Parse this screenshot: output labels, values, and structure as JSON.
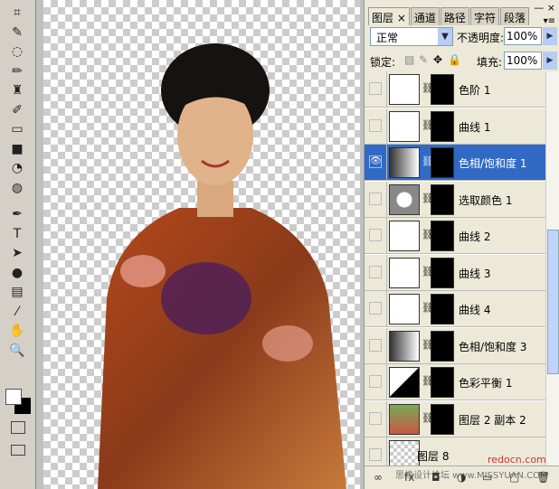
{
  "tools": [
    "crop-icon",
    "slice-icon",
    "lasso-icon",
    "brush-icon",
    "stamp-icon",
    "history-brush-icon",
    "eraser-icon",
    "gradient-icon",
    "blur-icon",
    "dodge-icon",
    "pen-icon",
    "type-icon",
    "path-select-icon",
    "shape-icon",
    "notes-icon",
    "eyedropper-icon",
    "hand-icon",
    "zoom-icon"
  ],
  "tool_glyphs": [
    "⌗",
    "✎",
    "◌",
    "✏",
    "♜",
    "✐",
    "▭",
    "■",
    "◔",
    "◍",
    "✒",
    "T",
    "➤",
    "●",
    "▤",
    "⁄",
    "✋",
    "🔍"
  ],
  "panel": {
    "tabs": [
      "图层",
      "通道",
      "路径",
      "字符",
      "段落"
    ],
    "close_tab": "×",
    "blend_mode": "正常",
    "opacity_label": "不透明度:",
    "opacity": "100%",
    "lock_label": "锁定:",
    "fill_label": "填充:",
    "fill": "100%"
  },
  "layers": [
    {
      "name": "色阶 1",
      "type": "levels",
      "visible": false,
      "selected": false
    },
    {
      "name": "曲线 1",
      "type": "curves",
      "visible": false,
      "selected": false
    },
    {
      "name": "色相/饱和度 1",
      "type": "hue-saturation",
      "visible": true,
      "selected": true
    },
    {
      "name": "选取颜色 1",
      "type": "selective-color",
      "visible": false,
      "selected": false
    },
    {
      "name": "曲线 2",
      "type": "curves",
      "visible": false,
      "selected": false
    },
    {
      "name": "曲线 3",
      "type": "curves",
      "visible": false,
      "selected": false
    },
    {
      "name": "曲线 4",
      "type": "curves",
      "visible": false,
      "selected": false
    },
    {
      "name": "色相/饱和度 3",
      "type": "hue-saturation",
      "visible": false,
      "selected": false
    },
    {
      "name": "色彩平衡 1",
      "type": "color-balance",
      "visible": false,
      "selected": false
    },
    {
      "name": "图层 2 副本 2",
      "type": "image",
      "visible": false,
      "selected": false
    },
    {
      "name": "图层 8",
      "type": "empty",
      "visible": false,
      "selected": false
    }
  ],
  "watermark": {
    "site1": "redocn.com",
    "site2": "思缘设计论坛 www.MISSYUAN.COM"
  }
}
